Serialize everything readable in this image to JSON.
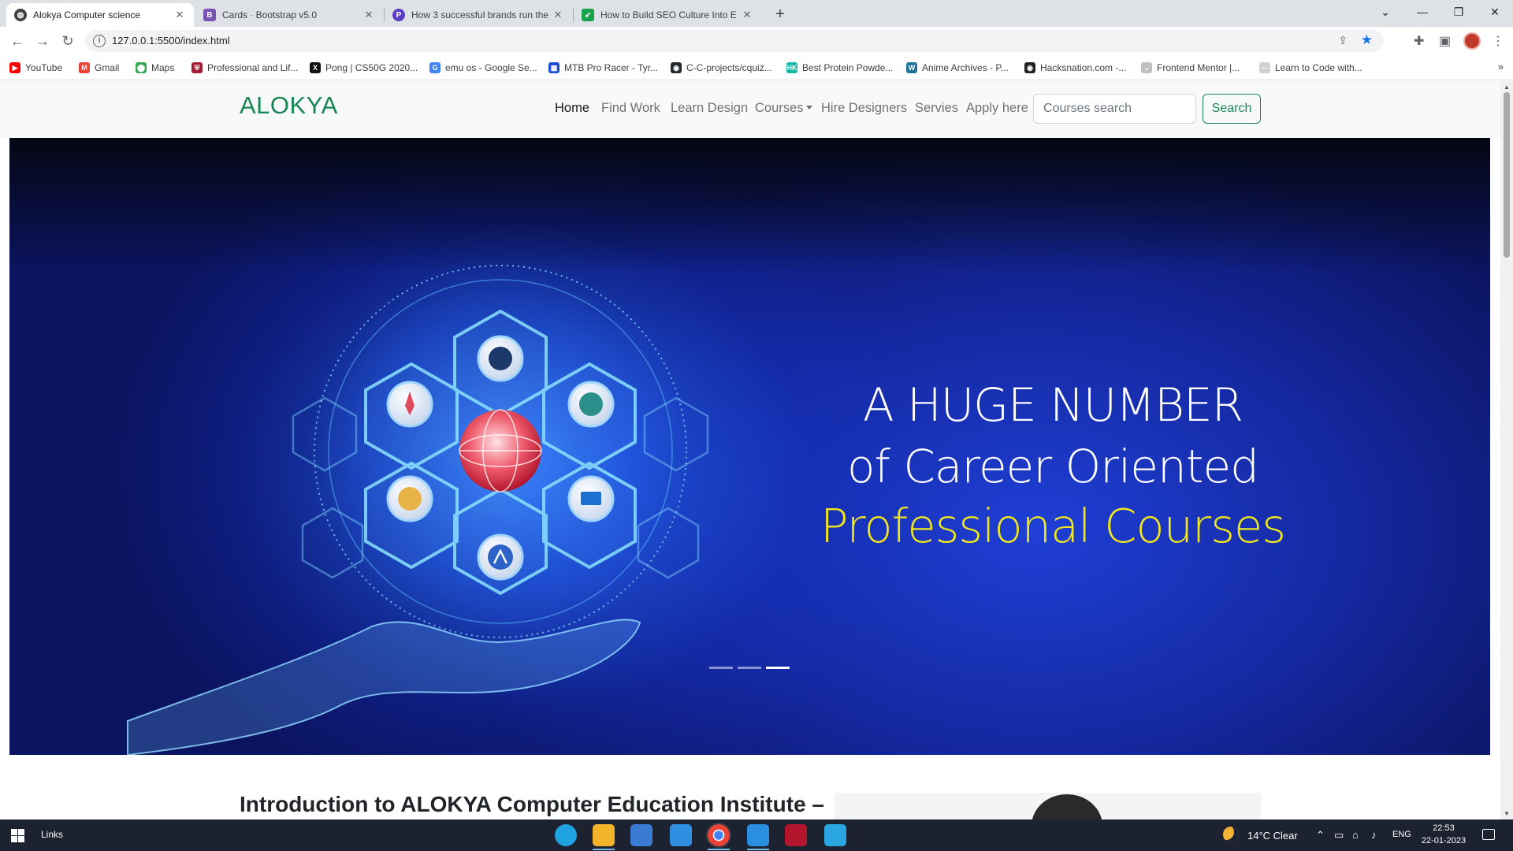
{
  "browser": {
    "tabs": [
      {
        "title": "Alokya Computer science",
        "active": true,
        "favicon": "globe-icon",
        "favicon_color": "#3c4043"
      },
      {
        "title": "Cards · Bootstrap v5.0",
        "active": false,
        "favicon": "bootstrap-icon",
        "favicon_color": "#7952b3"
      },
      {
        "title": "How 3 successful brands run the",
        "active": false,
        "favicon": "p-icon",
        "favicon_color": "#5b3cc4"
      },
      {
        "title": "How to Build SEO Culture Into E",
        "active": false,
        "favicon": "feather-icon",
        "favicon_color": "#16a34a"
      }
    ],
    "url": "127.0.0.1:5500/index.html",
    "bookmarks": [
      {
        "label": "YouTube",
        "icon": "youtube-icon",
        "color": "#ff0000"
      },
      {
        "label": "Gmail",
        "icon": "gmail-icon",
        "color": "#ea4335"
      },
      {
        "label": "Maps",
        "icon": "maps-icon",
        "color": "#34a853"
      },
      {
        "label": "Professional and Lif...",
        "icon": "shield-icon",
        "color": "#a51c30"
      },
      {
        "label": "Pong | CS50G 2020...",
        "icon": "x-icon",
        "color": "#111111"
      },
      {
        "label": "emu os - Google Se...",
        "icon": "google-icon",
        "color": "#4285f4"
      },
      {
        "label": "MTB Pro Racer - Tyr...",
        "icon": "game-icon",
        "color": "#1d4ed8"
      },
      {
        "label": "C-C-projects/cquiz...",
        "icon": "github-icon",
        "color": "#24292f"
      },
      {
        "label": "Best Protein Powde...",
        "icon": "hk-icon",
        "color": "#14b8a6"
      },
      {
        "label": "Anime Archives - P...",
        "icon": "wordpress-icon",
        "color": "#21759b"
      },
      {
        "label": "Hacksnation.com -...",
        "icon": "hacks-icon",
        "color": "#222222"
      },
      {
        "label": "Frontend Mentor |...",
        "icon": "frontend-icon",
        "color": "#c0c0c0"
      },
      {
        "label": "Learn to Code with...",
        "icon": "learn-icon",
        "color": "#d0d0d0"
      }
    ]
  },
  "site": {
    "brand": "ALOKYA",
    "brand_color": "#198754",
    "nav": [
      {
        "label": "Home",
        "active": true
      },
      {
        "label": "Find Work"
      },
      {
        "label": "Learn Design"
      },
      {
        "label": "Courses",
        "dropdown": true
      },
      {
        "label": "Hire Designers"
      },
      {
        "label": "Servies"
      },
      {
        "label": "Apply here"
      }
    ],
    "search": {
      "placeholder": "Courses search",
      "button": "Search"
    },
    "hero": {
      "line1": "A HUGE NUMBER",
      "line2": "of Career Oriented",
      "line3": "Professional Courses",
      "highlight_color": "#f1e61d",
      "slides": 3,
      "active_slide": 3
    },
    "intro_heading": "Introduction to ALOKYA Computer Education Institute –"
  },
  "taskbar": {
    "links_label": "Links",
    "apps": [
      "edge-icon",
      "file-explorer-icon",
      "store-icon",
      "mail-icon",
      "chrome-icon",
      "vscode-icon",
      "app-icon",
      "snip-icon"
    ],
    "weather": "14°C  Clear",
    "language": "ENG",
    "time": "22:53",
    "date": "22-01-2023"
  }
}
